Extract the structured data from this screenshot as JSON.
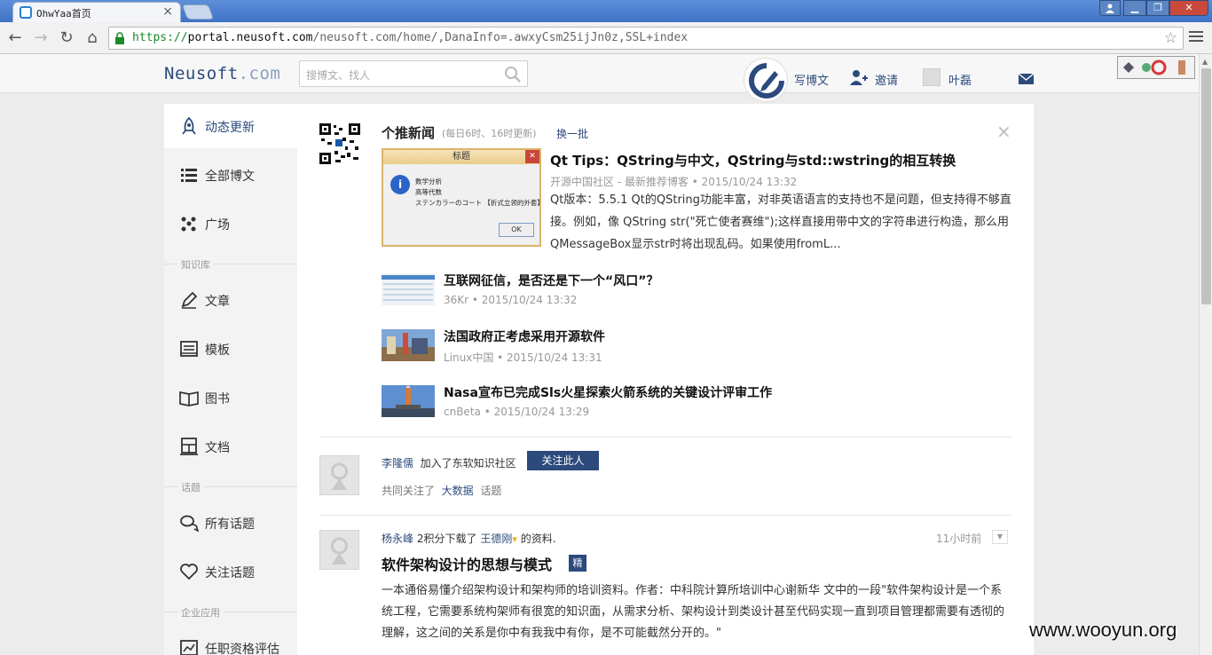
{
  "browser": {
    "tab_title": "OhwYaa首页",
    "url_scheme": "https://",
    "url_host": "portal.neusoft.com",
    "url_path": "/neusoft.com/home/,DanaInfo=.awxyCsm25ijJn0z,SSL+index"
  },
  "header": {
    "logo_main": "Neusoft",
    "logo_dot": ".",
    "logo_tld": "com",
    "search_placeholder": "搜博文、找人",
    "write_blog": "写博文",
    "invite": "邀请",
    "user_name": "叶磊"
  },
  "sidebar": {
    "items": [
      {
        "label": "动态更新",
        "icon": "rocket-icon"
      },
      {
        "label": "全部博文",
        "icon": "list-icon"
      },
      {
        "label": "广场",
        "icon": "dots-icon"
      },
      {
        "label": "文章",
        "icon": "pencil-icon"
      },
      {
        "label": "模板",
        "icon": "template-icon"
      },
      {
        "label": "图书",
        "icon": "book-icon"
      },
      {
        "label": "文档",
        "icon": "document-icon"
      },
      {
        "label": "所有话题",
        "icon": "chat-icon"
      },
      {
        "label": "关注话题",
        "icon": "heart-icon"
      },
      {
        "label": "任职资格评估",
        "icon": "chart-icon"
      }
    ],
    "sections": [
      "知识库",
      "话题",
      "企业应用"
    ]
  },
  "news": {
    "title": "个推新闻",
    "meta": "(每日6时、16时更新)",
    "refresh": "换一批",
    "close": "×",
    "dialog": {
      "caption": "标题",
      "icon_letter": "i",
      "lines": [
        "数学分析",
        "高等代数",
        "ステンカラーのコート  【折式立领的外套】"
      ],
      "ok": "OK"
    },
    "featured": {
      "title": "Qt Tips：QString与中文，QString与std::wstring的相互转换",
      "meta": "开源中国社区 - 最新推荐博客 • 2015/10/24 13:32",
      "body": "Qt版本：5.5.1 Qt的QString功能丰富，对非英语语言的支持也不是问题，但支持得不够直接。例如，像 QString str(\"死亡使者赛维\");这样直接用带中文的字符串进行构造，那么用QMessageBox显示str时将出现乱码。如果使用fromL..."
    },
    "items": [
      {
        "title": "互联网征信，是否还是下一个“风口”？",
        "meta": "36Kr • 2015/10/24 13:32"
      },
      {
        "title": "法国政府正考虑采用开源软件",
        "meta": "Linux中国 • 2015/10/24 13:31"
      },
      {
        "title": "Nasa宣布已完成Sls火星探索火箭系统的关键设计评审工作",
        "meta": "cnBeta • 2015/10/24 13:29"
      }
    ]
  },
  "feed1": {
    "user": "李隆儒",
    "action": "加入了东软知识社区",
    "follow_button": "关注此人",
    "sub_prefix": "共同关注了",
    "sub_topic": "大数据",
    "sub_suffix": "话题"
  },
  "feed2": {
    "user": "杨永峰",
    "action": "2积分下载了",
    "target_user": "王德刚",
    "action_suffix": "的资料.",
    "time": "11小时前",
    "doc_title": "软件架构设计的思想与模式",
    "badge": "精",
    "doc_body": "一本通俗易懂介绍架构设计和架构师的培训资料。作者：中科院计算所培训中心谢新华 文中的一段\"软件架构设计是一个系统工程，它需要系统构架师有很宽的知识面，从需求分析、架构设计到类设计甚至代码实现一直到项目管理都需要有透彻的理解，这之间的关系是你中有我我中有你，是不可能截然分开的。\""
  },
  "watermark": "www.wooyun.org",
  "colors": {
    "brand": "#2c4a7c",
    "chrome_tab": "#3f72c6",
    "close": "#c94a3c"
  }
}
